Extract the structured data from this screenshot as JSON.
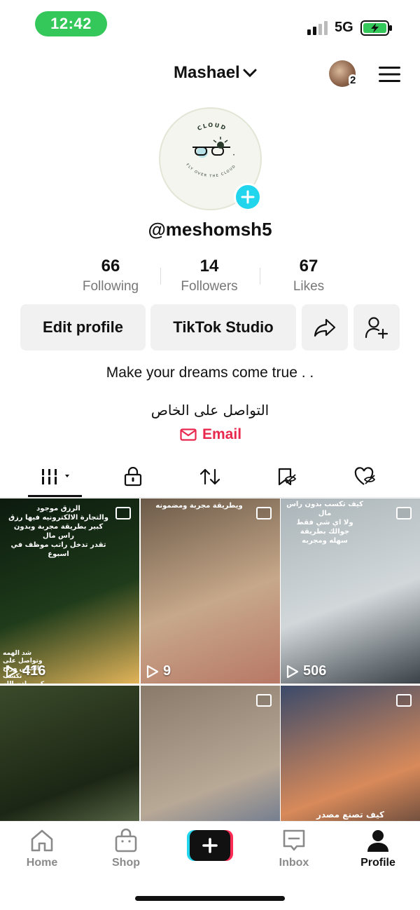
{
  "status_bar": {
    "time": "12:42",
    "network": "5G"
  },
  "header": {
    "username": "Mashael",
    "notification_count": "2"
  },
  "profile": {
    "handle": "@meshomsh5",
    "logo_text_top": "CLOUD",
    "logo_text_bottom": "FLY OVER THE CLOUD",
    "stats": [
      {
        "value": "66",
        "label": "Following"
      },
      {
        "value": "14",
        "label": "Followers"
      },
      {
        "value": "67",
        "label": "Likes"
      }
    ],
    "buttons": {
      "edit": "Edit profile",
      "studio": "TikTok Studio"
    },
    "bio": "Make your dreams come true . .",
    "bio_arabic": "التواصل على الخاص",
    "email_label": "Email"
  },
  "tabs": [
    "videos",
    "private",
    "reposts",
    "favorites",
    "liked"
  ],
  "grid": {
    "tiles": [
      {
        "caption": "الرزق موجود\nوالتجارة الالكترونيه فيها رزق\nكبير بطريقة مجربة وبدون راس مال\nتقدر تدخل راتب موظف في اسبوع",
        "caption2": "شد الهمه\nوتواصل على\nالخاص وراح تكسب\nكبير بإذن الله",
        "views": "416",
        "is_photo": true,
        "colors": [
          "#0c1a0e",
          "#1e3b1a",
          "#e2b45a"
        ]
      },
      {
        "caption": "ويطريقة مجربة ومضمونه",
        "caption2": "",
        "views": "9",
        "is_photo": true,
        "colors": [
          "#6b5a48",
          "#c7a88a",
          "#b87866"
        ]
      },
      {
        "caption": "كيف تكسب بدون راس\nمال\nولا اي شي فقط\nجوالك بطريقة\nسهله ومجربه",
        "caption2": "",
        "views": "506",
        "is_photo": true,
        "colors": [
          "#aab4b8",
          "#d2d8da",
          "#3a4148"
        ]
      },
      {
        "caption": "",
        "caption2": "",
        "views": "",
        "is_photo": false,
        "colors": [
          "#3a4a2a",
          "#1c2614",
          "#8a9a70"
        ]
      },
      {
        "caption": "",
        "caption2": "",
        "views": "",
        "is_photo": true,
        "colors": [
          "#8a7a6a",
          "#b8a896",
          "#3a5a8a"
        ]
      },
      {
        "caption": "كيف تصنع مصدر",
        "caption2": "",
        "views": "",
        "is_photo": true,
        "colors": [
          "#3a4a6a",
          "#d88a5a",
          "#1a1e28"
        ]
      }
    ]
  },
  "bottom_nav": [
    {
      "label": "Home",
      "icon": "home-icon"
    },
    {
      "label": "Shop",
      "icon": "shop-bag-icon"
    },
    {
      "label": "",
      "icon": "create-plus-icon"
    },
    {
      "label": "Inbox",
      "icon": "inbox-icon"
    },
    {
      "label": "Profile",
      "icon": "profile-icon"
    }
  ],
  "colors": {
    "accent_red": "#e8294d",
    "cyan": "#20d5ec",
    "status_green": "#34c759"
  }
}
